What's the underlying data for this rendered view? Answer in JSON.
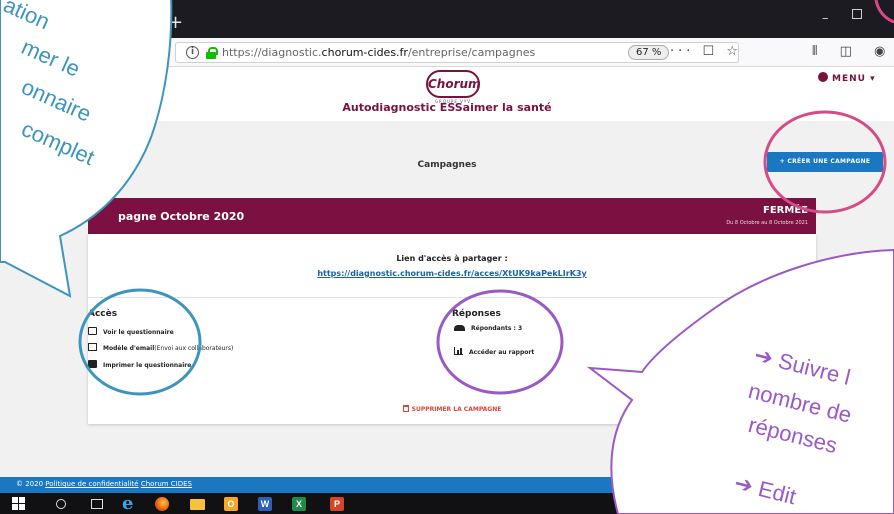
{
  "browser": {
    "new_tab_symbol": "+",
    "url_prefix": "https://diagnostic.",
    "url_domain": "chorum-cides.fr",
    "url_path": "/entreprise/campagnes",
    "zoom": "67 %",
    "url_actions": "··· ☐ ☆",
    "toolbar_icons": "⫴ ◫ ◉",
    "window_min": "–"
  },
  "header": {
    "logo_name": "Chorum",
    "logo_sub": "GROUPE VYV",
    "menu_label": "MENU",
    "menu_caret": "▾",
    "site_title": "Autodiagnostic ESSaimer la santé"
  },
  "page": {
    "title": "Campagnes",
    "create_button": "+ CRÉER UNE CAMPAGNE"
  },
  "campaign": {
    "name": "pagne Octobre 2020",
    "status": "FERMÉE",
    "dates": "Du 8 Octobre au 8 Octobre 2021",
    "share_title": "Lien d'accès à partager :",
    "share_link": "https://diagnostic.chorum-cides.fr/acces/XtUK9kaPekLIrK3y",
    "access": {
      "title": "Accès",
      "items": [
        {
          "label": "Voir le questionnaire",
          "icon": "card-icon"
        },
        {
          "label": "Modèle d'email",
          "note": "(Envoi aux collaborateurs)",
          "icon": "mail-icon"
        },
        {
          "label": "Imprimer le questionnaire",
          "icon": "print-icon"
        }
      ]
    },
    "responses": {
      "title": "Réponses",
      "items": [
        {
          "label": "Répondants : 3",
          "icon": "users-icon"
        },
        {
          "label": "Accéder au rapport",
          "icon": "chart-icon"
        }
      ]
    },
    "delete": "SUPPRIMER LA CAMPAGNE"
  },
  "footer": {
    "year": "© 2020",
    "privacy": "Politique de confidentialité",
    "brand": "Chorum CIDES"
  },
  "annotations": {
    "left_bubble_lines": [
      "ation",
      "mer le",
      "onnaire",
      "complet"
    ],
    "left_color": "#3d95bf",
    "right_bubble_lines": [
      "➔ Suivre l",
      "nombre de",
      "réponses",
      "➔ Edit"
    ],
    "right_color": "#9b59c6",
    "create_circle_color": "#d64a86"
  }
}
